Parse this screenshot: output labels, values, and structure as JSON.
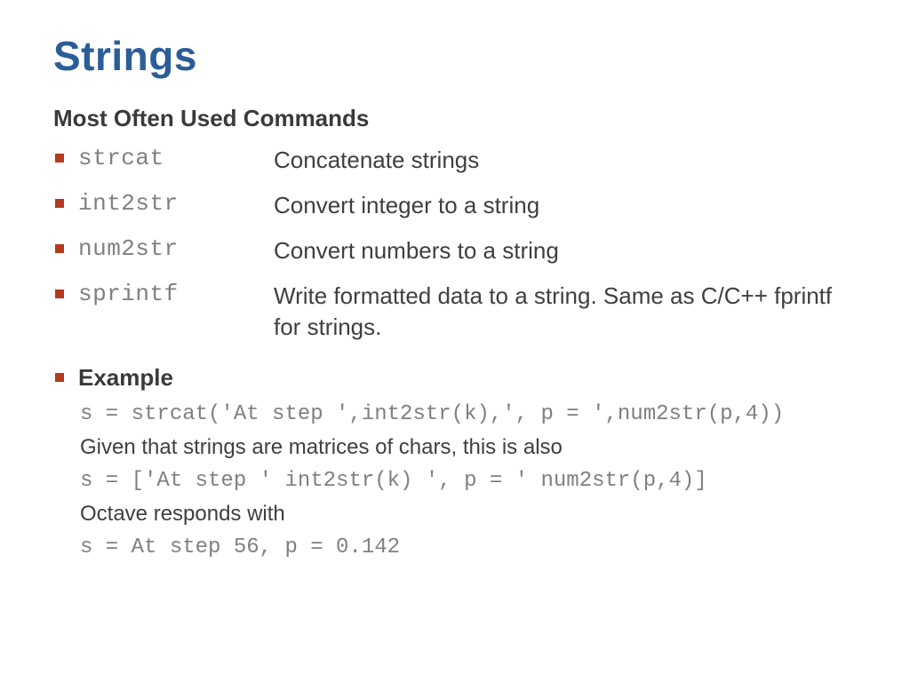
{
  "title": "Strings",
  "subheading": "Most Often Used Commands",
  "commands": [
    {
      "name": "strcat",
      "desc": "Concatenate strings"
    },
    {
      "name": "int2str",
      "desc": "Convert integer to a string"
    },
    {
      "name": "num2str",
      "desc": "Convert numbers to a string"
    },
    {
      "name": "sprintf",
      "desc": "Write formatted data to a string. Same as C/C++ fprintf for strings."
    }
  ],
  "example": {
    "label": "Example",
    "code1": "s = strcat('At step ',int2str(k),', p = ',num2str(p,4))",
    "prose1": "Given that strings are matrices of chars, this is also",
    "code2": "s = ['At step ' int2str(k) ', p = ' num2str(p,4)]",
    "prose2": "Octave responds with",
    "code3": "s = At step 56, p = 0.142"
  }
}
